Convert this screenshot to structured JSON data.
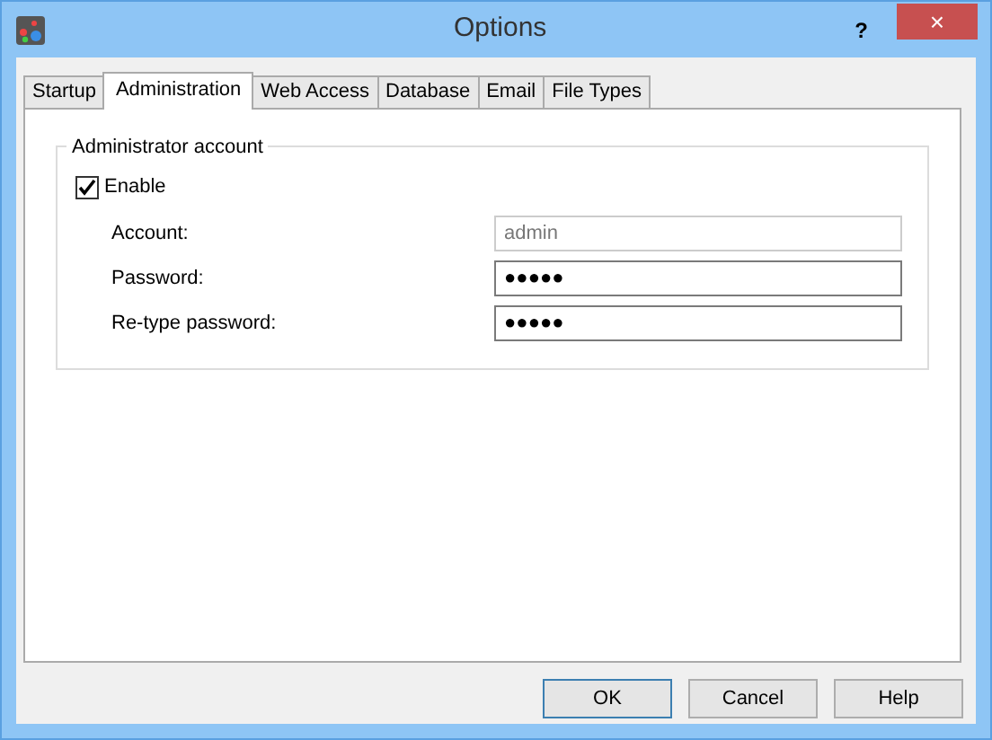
{
  "window": {
    "title": "Options",
    "help_button": "?",
    "close_button": "×"
  },
  "tabs": [
    {
      "label": "Startup",
      "selected": false
    },
    {
      "label": "Administration",
      "selected": true
    },
    {
      "label": "Web Access",
      "selected": false
    },
    {
      "label": "Database",
      "selected": false
    },
    {
      "label": "Email",
      "selected": false
    },
    {
      "label": "File Types",
      "selected": false
    }
  ],
  "group": {
    "title": "Administrator account",
    "enable": {
      "label": "Enable",
      "checked": true
    },
    "fields": [
      {
        "label": "Account:",
        "value": "admin",
        "disabled": true
      },
      {
        "label": "Password:",
        "value": "●●●●●",
        "disabled": false
      },
      {
        "label": "Re-type password:",
        "value": "●●●●●",
        "disabled": false
      }
    ]
  },
  "buttons": [
    {
      "label": "OK",
      "default": true
    },
    {
      "label": "Cancel",
      "default": false
    },
    {
      "label": "Help",
      "default": false
    }
  ]
}
